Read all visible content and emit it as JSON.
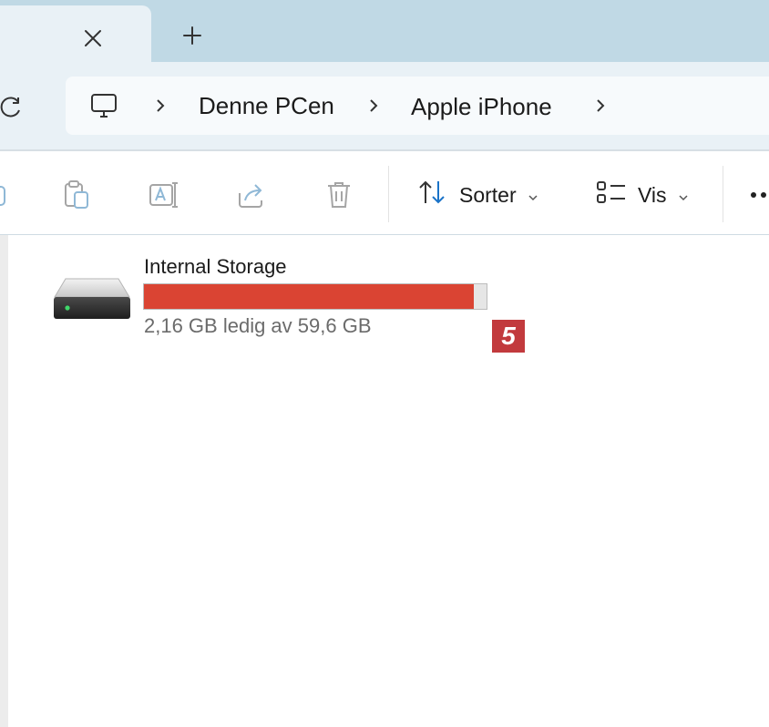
{
  "tabbar": {
    "close_icon": "close-icon",
    "new_tab_icon": "plus-icon"
  },
  "address": {
    "refresh_icon": "refresh-icon",
    "root_icon": "monitor-icon",
    "crumbs": [
      "Denne PCen",
      "Apple iPhone"
    ]
  },
  "toolbar": {
    "icons": [
      "copy-icon",
      "paste-icon",
      "rename-icon",
      "share-icon",
      "delete-icon"
    ],
    "sort_label": "Sorter",
    "view_label": "Vis",
    "more_icon": "more-icon"
  },
  "content": {
    "drive": {
      "name": "Internal Storage",
      "icon": "drive-icon",
      "used_fraction": 0.964,
      "status": "2,16 GB ledig av 59,6 GB",
      "bar_color": "#da4433"
    },
    "badge": "5"
  }
}
